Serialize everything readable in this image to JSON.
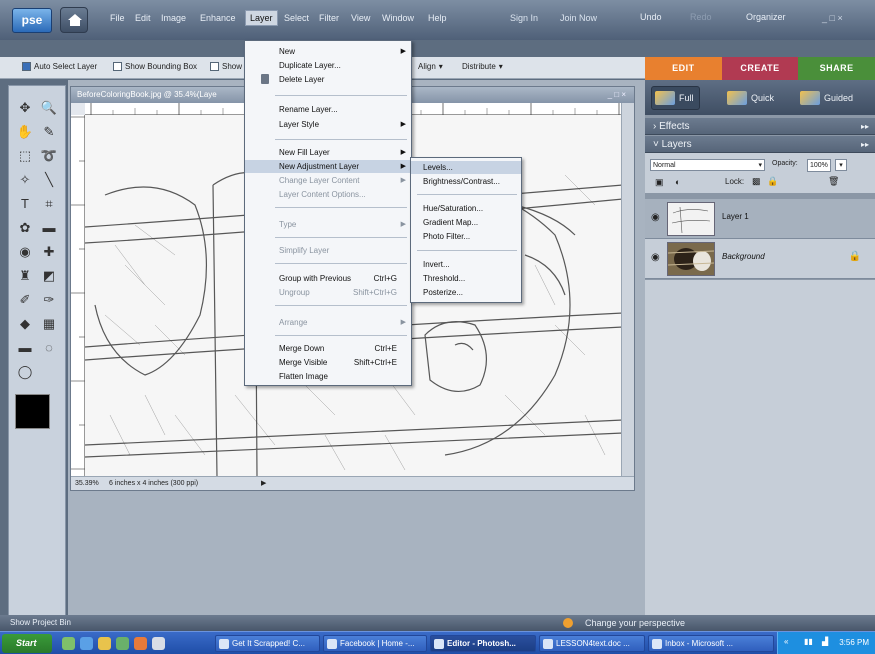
{
  "app": {
    "logo": "pse",
    "menus": [
      "File",
      "Edit",
      "Image",
      "Enhance",
      "Layer",
      "Select",
      "Filter",
      "View",
      "Window",
      "Help"
    ],
    "sign_in": "Sign In",
    "join_now": "Join Now",
    "undo": "Undo",
    "redo": "Redo",
    "organizer": "Organizer",
    "win_controls": "_ □ ×"
  },
  "options_bar": {
    "auto_select": "Auto Select Layer",
    "bounding_box": "Show Bounding Box",
    "show": "Show",
    "align": "Align",
    "distribute": "Distribute"
  },
  "mode_tabs": [
    "EDIT",
    "CREATE",
    "SHARE"
  ],
  "document": {
    "title": "BeforeColoringBook.jpg @ 35.4%(Laye",
    "zoom": "35.39%",
    "size": "6 inches x 4 inches (300 ppi)",
    "window_controls": "_ □ ×"
  },
  "right_panel": {
    "view_tabs": [
      "Full",
      "Quick",
      "Guided"
    ],
    "effects": "Effects",
    "layers": "Layers",
    "blend_mode": "Normal",
    "opacity_label": "Opacity:",
    "opacity_value": "100%",
    "lock_label": "Lock:",
    "layers_list": [
      {
        "name": "Layer 1"
      },
      {
        "name": "Background"
      }
    ]
  },
  "layer_menu": {
    "new": "New",
    "duplicate": "Duplicate Layer...",
    "delete": "Delete Layer",
    "rename": "Rename Layer...",
    "style": "Layer Style",
    "new_fill": "New Fill Layer",
    "new_adjustment": "New Adjustment Layer",
    "change_content": "Change Layer Content",
    "content_options": "Layer Content Options...",
    "type": "Type",
    "simplify": "Simplify Layer",
    "group": "Group with Previous",
    "group_sc": "Ctrl+G",
    "ungroup": "Ungroup",
    "ungroup_sc": "Shift+Ctrl+G",
    "arrange": "Arrange",
    "merge_down": "Merge Down",
    "merge_down_sc": "Ctrl+E",
    "merge_visible": "Merge Visible",
    "merge_visible_sc": "Shift+Ctrl+E",
    "flatten": "Flatten Image"
  },
  "adjustment_submenu": {
    "levels": "Levels...",
    "brightness": "Brightness/Contrast...",
    "hue": "Hue/Saturation...",
    "gradient": "Gradient Map...",
    "photo_filter": "Photo Filter...",
    "invert": "Invert...",
    "threshold": "Threshold...",
    "posterize": "Posterize..."
  },
  "bin_bar": {
    "show_bin": "Show Project Bin",
    "perspective": "Change your perspective"
  },
  "taskbar": {
    "start": "Start",
    "tasks": [
      "Get It Scrapped! C...",
      "Facebook | Home -...",
      "Editor - Photosh...",
      "LESSON4text.doc ...",
      "Inbox - Microsoft ..."
    ],
    "clock": "3:56 PM",
    "tray": "«"
  }
}
